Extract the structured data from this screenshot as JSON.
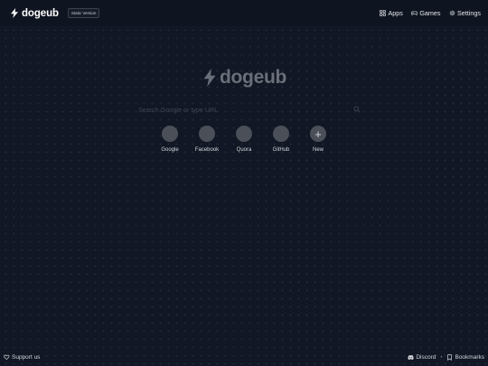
{
  "brand": {
    "name": "dogeub",
    "version": "Static Version"
  },
  "nav": [
    {
      "label": "Apps",
      "icon": "apps-icon"
    },
    {
      "label": "Games",
      "icon": "gamepad-icon"
    },
    {
      "label": "Settings",
      "icon": "gear-icon"
    }
  ],
  "hero": {
    "name": "dogeub"
  },
  "search": {
    "placeholder": "Search Google or type URL",
    "value": ""
  },
  "shortcuts": [
    {
      "label": "Google",
      "icon": ""
    },
    {
      "label": "Facebook",
      "icon": ""
    },
    {
      "label": "Quora",
      "icon": ""
    },
    {
      "label": "GitHub",
      "icon": ""
    },
    {
      "label": "New",
      "icon": "+"
    }
  ],
  "footer": {
    "support": "Support us",
    "discord": "Discord",
    "separator": "•",
    "bookmarks": "Bookmarks"
  },
  "colors": {
    "background": "#111724",
    "topbar": "#0f1520",
    "shortcut_circle": "#4b4f58",
    "hero_text": "#6a6f79"
  }
}
